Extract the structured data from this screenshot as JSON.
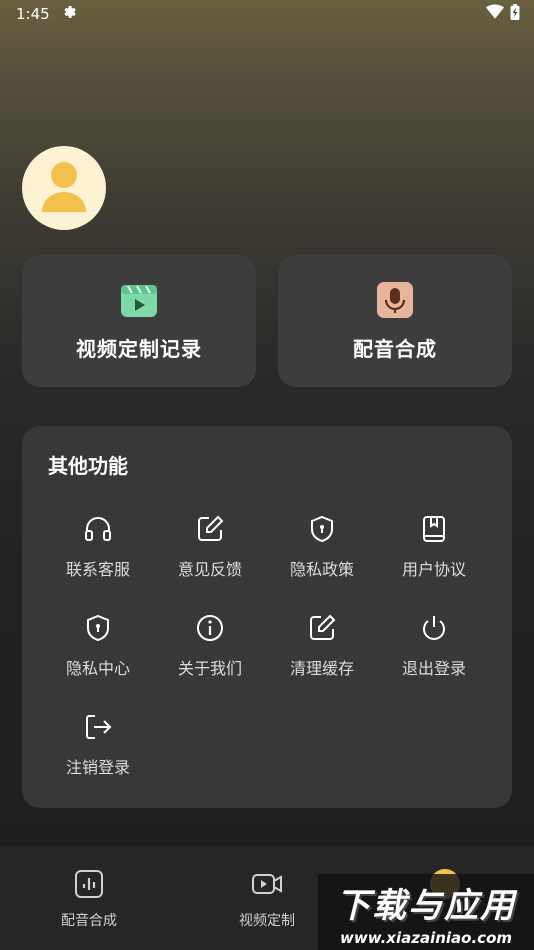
{
  "status_bar": {
    "time": "1:45"
  },
  "cards": [
    {
      "label": "视频定制记录",
      "icon": "video-clapper-icon",
      "color": "#7ed9a8"
    },
    {
      "label": "配音合成",
      "icon": "microphone-icon",
      "color": "#e6b59b"
    }
  ],
  "panel": {
    "title": "其他功能",
    "items": [
      {
        "label": "联系客服",
        "icon": "headphones-icon"
      },
      {
        "label": "意见反馈",
        "icon": "edit-icon"
      },
      {
        "label": "隐私政策",
        "icon": "shield-icon"
      },
      {
        "label": "用户协议",
        "icon": "book-icon"
      },
      {
        "label": "隐私中心",
        "icon": "shield-icon"
      },
      {
        "label": "关于我们",
        "icon": "info-icon"
      },
      {
        "label": "清理缓存",
        "icon": "edit-icon"
      },
      {
        "label": "退出登录",
        "icon": "power-icon"
      },
      {
        "label": "注销登录",
        "icon": "logout-icon"
      }
    ]
  },
  "bottom_nav": {
    "items": [
      {
        "label": "配音合成",
        "icon": "audio-bars-icon"
      },
      {
        "label": "视频定制",
        "icon": "video-camera-icon"
      },
      {
        "label": "",
        "icon": "profile-dot-icon"
      }
    ]
  },
  "watermark": {
    "title": "下载与应用",
    "url": "www.xiazainiao.com"
  },
  "colors": {
    "accent": "#f2c14e",
    "avatar_bg": "#fdf1d4",
    "panel_bg": "#383838"
  }
}
